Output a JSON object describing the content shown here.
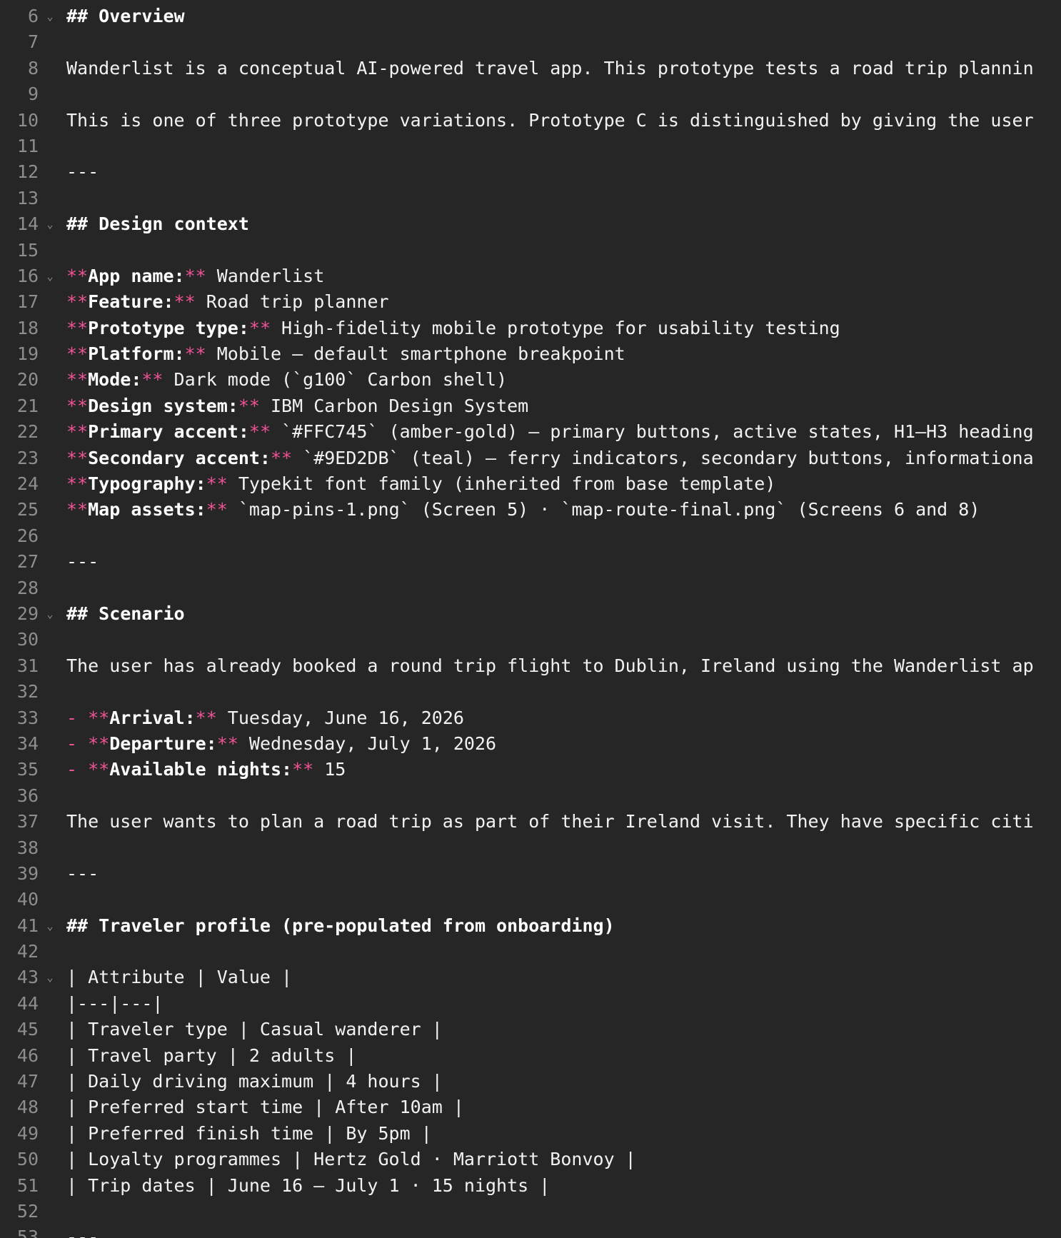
{
  "editor": {
    "colors": {
      "background": "#262626",
      "text": "#f2f2f2",
      "line_number": "#8d8d8d",
      "markdown_marker": "#ee5396"
    },
    "lines": [
      {
        "num": "6",
        "fold": true,
        "segments": [
          {
            "type": "heading",
            "text": "## Overview"
          }
        ]
      },
      {
        "num": "7",
        "fold": false,
        "segments": []
      },
      {
        "num": "8",
        "fold": false,
        "segments": [
          {
            "type": "text",
            "text": "Wanderlist is a conceptual AI-powered travel app. This prototype tests a road trip plannin"
          }
        ]
      },
      {
        "num": "9",
        "fold": false,
        "segments": []
      },
      {
        "num": "10",
        "fold": false,
        "segments": [
          {
            "type": "text",
            "text": "This is one of three prototype variations. Prototype C is distinguished by giving the user"
          }
        ]
      },
      {
        "num": "11",
        "fold": false,
        "segments": []
      },
      {
        "num": "12",
        "fold": false,
        "segments": [
          {
            "type": "rule",
            "text": "---"
          }
        ]
      },
      {
        "num": "13",
        "fold": false,
        "segments": []
      },
      {
        "num": "14",
        "fold": true,
        "segments": [
          {
            "type": "heading",
            "text": "## Design context"
          }
        ]
      },
      {
        "num": "15",
        "fold": false,
        "segments": []
      },
      {
        "num": "16",
        "fold": true,
        "segments": [
          {
            "type": "mark",
            "text": "**"
          },
          {
            "type": "bold",
            "text": "App name:"
          },
          {
            "type": "mark",
            "text": "**"
          },
          {
            "type": "text",
            "text": " Wanderlist"
          }
        ]
      },
      {
        "num": "17",
        "fold": false,
        "segments": [
          {
            "type": "mark",
            "text": "**"
          },
          {
            "type": "bold",
            "text": "Feature:"
          },
          {
            "type": "mark",
            "text": "**"
          },
          {
            "type": "text",
            "text": " Road trip planner"
          }
        ]
      },
      {
        "num": "18",
        "fold": false,
        "segments": [
          {
            "type": "mark",
            "text": "**"
          },
          {
            "type": "bold",
            "text": "Prototype type:"
          },
          {
            "type": "mark",
            "text": "**"
          },
          {
            "type": "text",
            "text": " High-fidelity mobile prototype for usability testing"
          }
        ]
      },
      {
        "num": "19",
        "fold": false,
        "segments": [
          {
            "type": "mark",
            "text": "**"
          },
          {
            "type": "bold",
            "text": "Platform:"
          },
          {
            "type": "mark",
            "text": "**"
          },
          {
            "type": "text",
            "text": " Mobile — default smartphone breakpoint"
          }
        ]
      },
      {
        "num": "20",
        "fold": false,
        "segments": [
          {
            "type": "mark",
            "text": "**"
          },
          {
            "type": "bold",
            "text": "Mode:"
          },
          {
            "type": "mark",
            "text": "**"
          },
          {
            "type": "text",
            "text": " Dark mode (`g100` Carbon shell)"
          }
        ]
      },
      {
        "num": "21",
        "fold": false,
        "segments": [
          {
            "type": "mark",
            "text": "**"
          },
          {
            "type": "bold",
            "text": "Design system:"
          },
          {
            "type": "mark",
            "text": "**"
          },
          {
            "type": "text",
            "text": " IBM Carbon Design System"
          }
        ]
      },
      {
        "num": "22",
        "fold": false,
        "segments": [
          {
            "type": "mark",
            "text": "**"
          },
          {
            "type": "bold",
            "text": "Primary accent:"
          },
          {
            "type": "mark",
            "text": "**"
          },
          {
            "type": "text",
            "text": " `#FFC745` (amber-gold) — primary buttons, active states, H1–H3 heading"
          }
        ]
      },
      {
        "num": "23",
        "fold": false,
        "segments": [
          {
            "type": "mark",
            "text": "**"
          },
          {
            "type": "bold",
            "text": "Secondary accent:"
          },
          {
            "type": "mark",
            "text": "**"
          },
          {
            "type": "text",
            "text": " `#9ED2DB` (teal) — ferry indicators, secondary buttons, informationa"
          }
        ]
      },
      {
        "num": "24",
        "fold": false,
        "segments": [
          {
            "type": "mark",
            "text": "**"
          },
          {
            "type": "bold",
            "text": "Typography:"
          },
          {
            "type": "mark",
            "text": "**"
          },
          {
            "type": "text",
            "text": " Typekit font family (inherited from base template)"
          }
        ]
      },
      {
        "num": "25",
        "fold": false,
        "segments": [
          {
            "type": "mark",
            "text": "**"
          },
          {
            "type": "bold",
            "text": "Map assets:"
          },
          {
            "type": "mark",
            "text": "**"
          },
          {
            "type": "text",
            "text": " `map-pins-1.png` (Screen 5) · `map-route-final.png` (Screens 6 and 8)"
          }
        ]
      },
      {
        "num": "26",
        "fold": false,
        "segments": []
      },
      {
        "num": "27",
        "fold": false,
        "segments": [
          {
            "type": "rule",
            "text": "---"
          }
        ]
      },
      {
        "num": "28",
        "fold": false,
        "segments": []
      },
      {
        "num": "29",
        "fold": true,
        "segments": [
          {
            "type": "heading",
            "text": "## Scenario"
          }
        ]
      },
      {
        "num": "30",
        "fold": false,
        "segments": []
      },
      {
        "num": "31",
        "fold": false,
        "segments": [
          {
            "type": "text",
            "text": "The user has already booked a round trip flight to Dublin, Ireland using the Wanderlist ap"
          }
        ]
      },
      {
        "num": "32",
        "fold": false,
        "segments": []
      },
      {
        "num": "33",
        "fold": false,
        "segments": [
          {
            "type": "mark",
            "text": "- **"
          },
          {
            "type": "bold",
            "text": "Arrival:"
          },
          {
            "type": "mark",
            "text": "**"
          },
          {
            "type": "text",
            "text": " Tuesday, June 16, 2026"
          }
        ]
      },
      {
        "num": "34",
        "fold": false,
        "segments": [
          {
            "type": "mark",
            "text": "- **"
          },
          {
            "type": "bold",
            "text": "Departure:"
          },
          {
            "type": "mark",
            "text": "**"
          },
          {
            "type": "text",
            "text": " Wednesday, July 1, 2026"
          }
        ]
      },
      {
        "num": "35",
        "fold": false,
        "segments": [
          {
            "type": "mark",
            "text": "- **"
          },
          {
            "type": "bold",
            "text": "Available nights:"
          },
          {
            "type": "mark",
            "text": "**"
          },
          {
            "type": "text",
            "text": " 15"
          }
        ]
      },
      {
        "num": "36",
        "fold": false,
        "segments": []
      },
      {
        "num": "37",
        "fold": false,
        "segments": [
          {
            "type": "text",
            "text": "The user wants to plan a road trip as part of their Ireland visit. They have specific citi"
          }
        ]
      },
      {
        "num": "38",
        "fold": false,
        "segments": []
      },
      {
        "num": "39",
        "fold": false,
        "segments": [
          {
            "type": "rule",
            "text": "---"
          }
        ]
      },
      {
        "num": "40",
        "fold": false,
        "segments": []
      },
      {
        "num": "41",
        "fold": true,
        "segments": [
          {
            "type": "heading",
            "text": "## Traveler profile (pre-populated from onboarding)"
          }
        ]
      },
      {
        "num": "42",
        "fold": false,
        "segments": []
      },
      {
        "num": "43",
        "fold": true,
        "segments": [
          {
            "type": "text",
            "text": "| Attribute | Value |"
          }
        ]
      },
      {
        "num": "44",
        "fold": false,
        "segments": [
          {
            "type": "text",
            "text": "|---|---|"
          }
        ]
      },
      {
        "num": "45",
        "fold": false,
        "segments": [
          {
            "type": "text",
            "text": "| Traveler type | Casual wanderer |"
          }
        ]
      },
      {
        "num": "46",
        "fold": false,
        "segments": [
          {
            "type": "text",
            "text": "| Travel party | 2 adults |"
          }
        ]
      },
      {
        "num": "47",
        "fold": false,
        "segments": [
          {
            "type": "text",
            "text": "| Daily driving maximum | 4 hours |"
          }
        ]
      },
      {
        "num": "48",
        "fold": false,
        "segments": [
          {
            "type": "text",
            "text": "| Preferred start time | After 10am |"
          }
        ]
      },
      {
        "num": "49",
        "fold": false,
        "segments": [
          {
            "type": "text",
            "text": "| Preferred finish time | By 5pm |"
          }
        ]
      },
      {
        "num": "50",
        "fold": false,
        "segments": [
          {
            "type": "text",
            "text": "| Loyalty programmes | Hertz Gold · Marriott Bonvoy |"
          }
        ]
      },
      {
        "num": "51",
        "fold": false,
        "segments": [
          {
            "type": "text",
            "text": "| Trip dates | June 16 – July 1 · 15 nights |"
          }
        ]
      },
      {
        "num": "52",
        "fold": false,
        "segments": []
      },
      {
        "num": "53",
        "fold": false,
        "segments": [
          {
            "type": "rule",
            "text": "---"
          }
        ]
      }
    ]
  }
}
